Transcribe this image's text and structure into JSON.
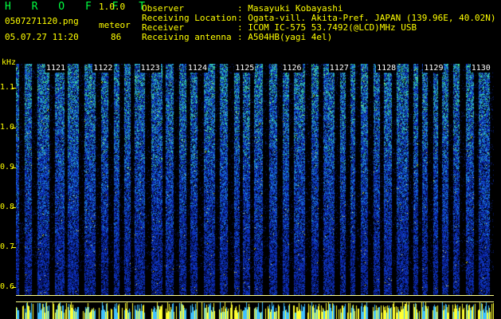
{
  "header": {
    "app_name": "H R O F F T",
    "version": "1.0.0",
    "filename": "0507271120.png",
    "mode_label": "meteor",
    "datetime": "05.07.27 11:20",
    "meteor_count": "86"
  },
  "metadata": [
    {
      "label": "Observer",
      "value": ": Masayuki Kobayashi"
    },
    {
      "label": "Receiving Location",
      "value": ": Ogata-vill. Akita-Pref. JAPAN (139.96E, 40.02N)"
    },
    {
      "label": "Receiver",
      "value": ": ICOM IC-575 53.7492(@LCD)MHz USB"
    },
    {
      "label": "Receiving antenna",
      "value": ": A504HB(yagi 4el)"
    }
  ],
  "chart_data": {
    "type": "heatmap",
    "y_unit_label": "kHz",
    "y_ticks": [
      "1.1",
      "1.0",
      "0.9",
      "0.8",
      "0.7",
      "0.6"
    ],
    "x_ticks": [
      "1121",
      "1122",
      "1123",
      "1124",
      "1125",
      "1126",
      "1127",
      "1128",
      "1129",
      "1130"
    ],
    "ylim": [
      0.6,
      1.2
    ],
    "colors": {
      "bg": "#000000",
      "low": "#0a1aa0",
      "mid": "#1e6ad8",
      "high": "#40e0a0",
      "hot": "#ffff40"
    }
  }
}
